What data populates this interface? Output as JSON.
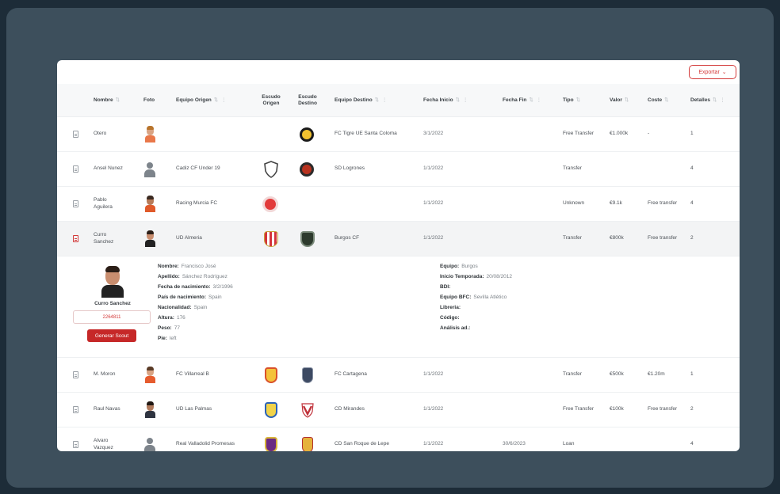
{
  "export_label": "Exportar",
  "columns": [
    "Nombre",
    "Foto",
    "Equipo Origen",
    "Escudo Origen",
    "Escudo Destino",
    "Equipo Destino",
    "Fecha Inicio",
    "Fecha Fin",
    "Tipo",
    "Valor",
    "Coste",
    "Detalles"
  ],
  "rows": [
    {
      "name": "Otero",
      "origin": "",
      "dest": "FC Tigre UE Santa Coloma",
      "start": "3/1/2022",
      "end": "",
      "type": "Free Transfer",
      "value": "€1.000k",
      "cost": "-",
      "details": "1"
    },
    {
      "name": "Ansel Nunez",
      "origin": "Cadiz CF Under 19",
      "dest": "SD Logrones",
      "start": "1/1/2022",
      "end": "",
      "type": "Transfer",
      "value": "",
      "cost": "",
      "details": "4"
    },
    {
      "name": "Pablo Aguilera",
      "origin": "Racing Murcia FC",
      "dest": "",
      "start": "1/1/2022",
      "end": "",
      "type": "Unknown",
      "value": "€9.1k",
      "cost": "Free transfer",
      "details": "4"
    },
    {
      "name": "Curro Sanchez",
      "origin": "UD Almeria",
      "dest": "Burgos CF",
      "start": "1/1/2022",
      "end": "",
      "type": "Transfer",
      "value": "€800k",
      "cost": "Free transfer",
      "details": "2"
    },
    {
      "name": "M. Moron",
      "origin": "FC Villarreal B",
      "dest": "FC Cartagena",
      "start": "1/1/2022",
      "end": "",
      "type": "Transfer",
      "value": "€500k",
      "cost": "€1.20m",
      "details": "1"
    },
    {
      "name": "Raul Navas",
      "origin": "UD Las Palmas",
      "dest": "CD Mirandes",
      "start": "1/1/2022",
      "end": "",
      "type": "Free Transfer",
      "value": "€100k",
      "cost": "Free transfer",
      "details": "2"
    },
    {
      "name": "Alvaro Vazquez",
      "origin": "Real Valladolid Promesas",
      "dest": "CD San Roque de Lepe",
      "start": "1/1/2022",
      "end": "30/6/2023",
      "type": "Loan",
      "value": "",
      "cost": "",
      "details": "4"
    }
  ],
  "detail": {
    "photo_caption": "Curro Sanchez",
    "input_value": "2264811",
    "button_label": "Generar Scout",
    "left": [
      {
        "k": "Nombre:",
        "v": "Francisco José"
      },
      {
        "k": "Apellido:",
        "v": "Sánchez Rodríguez"
      },
      {
        "k": "Fecha de nacimiento:",
        "v": "3/2/1996"
      },
      {
        "k": "País de nacimiento:",
        "v": "Spain"
      },
      {
        "k": "Nacionalidad:",
        "v": "Spain"
      },
      {
        "k": "Altura:",
        "v": "176"
      },
      {
        "k": "Peso:",
        "v": "77"
      },
      {
        "k": "Pie:",
        "v": "left"
      }
    ],
    "right": [
      {
        "k": "Equipo:",
        "v": "Burgos"
      },
      {
        "k": "Inicio Temporada:",
        "v": "20/08/2012"
      },
      {
        "k": "BDI:",
        "v": ""
      },
      {
        "k": "Equipo BFC:",
        "v": "Sevilla Atlético"
      },
      {
        "k": "Libreria:",
        "v": ""
      },
      {
        "k": "Código:",
        "v": ""
      },
      {
        "k": "Análisis ad.:",
        "v": ""
      }
    ]
  },
  "colors": {
    "accent": "#d33a3a",
    "button": "#c62828",
    "background": "#1d2c38",
    "frame": "#3d4f5c"
  },
  "icons": [
    "document-icon",
    "player-photo",
    "club-crest",
    "sort-icon",
    "chevron-down-icon"
  ]
}
